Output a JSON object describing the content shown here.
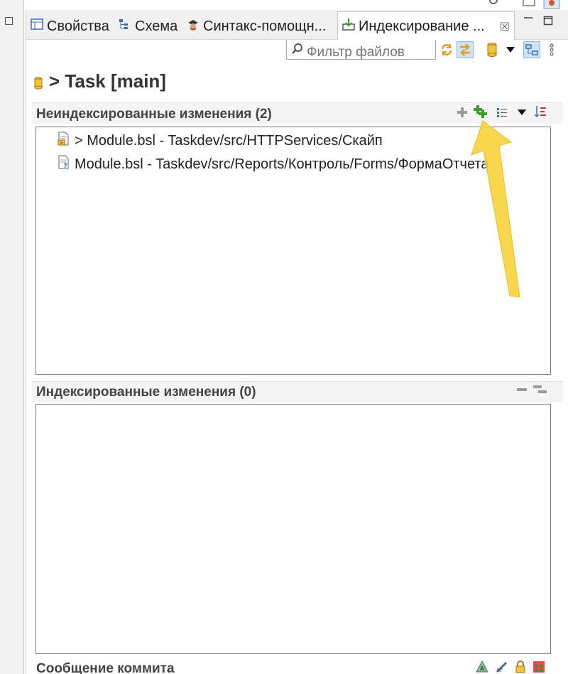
{
  "tabs": [
    {
      "label": "Свойства",
      "icon": "properties-icon"
    },
    {
      "label": "Схема",
      "icon": "outline-icon"
    },
    {
      "label": "Синтакс-помощн...",
      "icon": "syntax-assistant-icon"
    }
  ],
  "active_tab": {
    "label": "Индексирование ...",
    "icon": "staging-icon",
    "close": "☒"
  },
  "filter": {
    "placeholder": "Фильтр файлов"
  },
  "repository": {
    "title": "> Task [main]",
    "icon": "repository-icon"
  },
  "unstaged": {
    "title": "Неиндексированные изменения (2)",
    "items": [
      {
        "text": "> Module.bsl - Taskdev/src/HTTPServices/Скайп",
        "icon": "modified-file-icon"
      },
      {
        "text": "Module.bsl - Taskdev/src/Reports/Контроль/Forms/ФормаОтчета",
        "icon": "untracked-file-icon"
      }
    ]
  },
  "staged": {
    "title": "Индексированные изменения (0)",
    "items": []
  },
  "commit": {
    "title": "Сообщение коммита"
  },
  "colors": {
    "accent_green": "#3c9a2e",
    "arrow_yellow": "#f7d23a",
    "pressed_bg": "#cfe3f7",
    "db_yellow": "#f3c33a"
  }
}
